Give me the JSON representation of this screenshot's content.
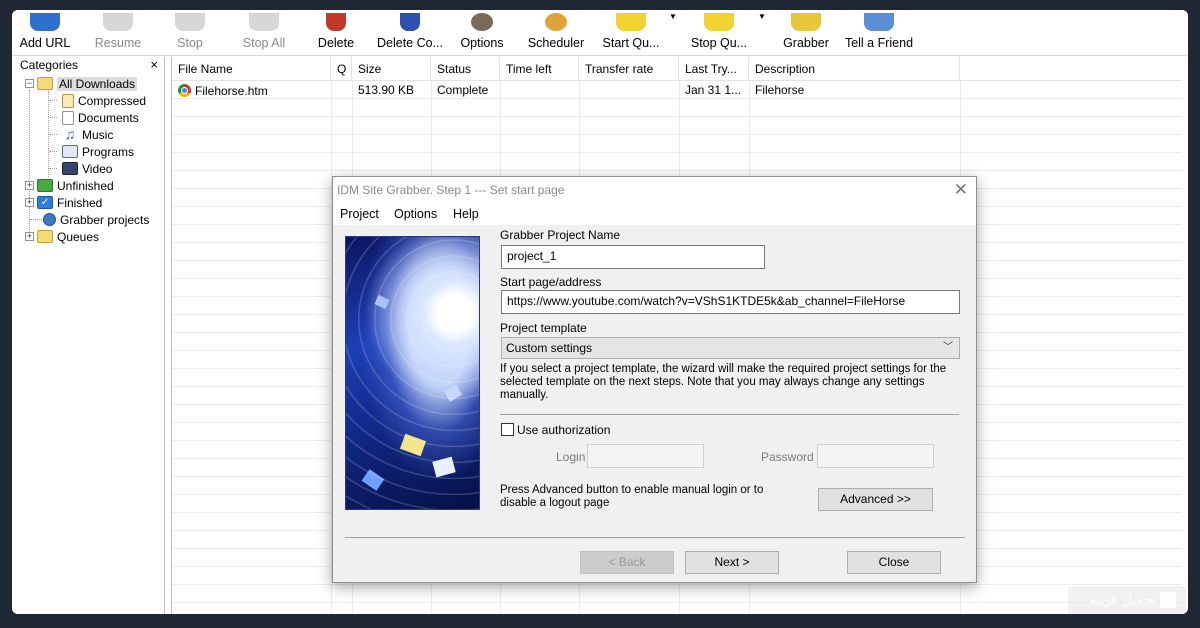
{
  "toolbar": {
    "buttons": [
      {
        "label": "Add URL",
        "enabled": true,
        "icon": "add-url-icon",
        "color": "#2f6fd0"
      },
      {
        "label": "Resume",
        "enabled": false,
        "icon": "resume-icon",
        "color": "#c9c9c9"
      },
      {
        "label": "Stop",
        "enabled": false,
        "icon": "stop-icon",
        "color": "#c9c9c9"
      },
      {
        "label": "Stop All",
        "enabled": false,
        "icon": "stop-all-icon",
        "color": "#c9c9c9"
      },
      {
        "label": "Delete",
        "enabled": true,
        "icon": "delete-icon",
        "color": "#c0392b"
      },
      {
        "label": "Delete Co...",
        "enabled": true,
        "icon": "delete-completed-icon",
        "color": "#2f50b0"
      },
      {
        "label": "Options",
        "enabled": true,
        "icon": "options-gear-icon",
        "color": "#6b6b6b"
      },
      {
        "label": "Scheduler",
        "enabled": true,
        "icon": "scheduler-clock-icon",
        "color": "#e0a23a"
      },
      {
        "label": "Start Qu...",
        "enabled": true,
        "icon": "start-queue-icon",
        "color": "#f1d234"
      },
      {
        "label": "Stop Qu...",
        "enabled": true,
        "icon": "stop-queue-icon",
        "color": "#f1d234"
      },
      {
        "label": "Grabber",
        "enabled": true,
        "icon": "grabber-icon",
        "color": "#f1d234"
      },
      {
        "label": "Tell a Friend",
        "enabled": true,
        "icon": "tell-friend-icon",
        "color": "#5a8fd8"
      }
    ]
  },
  "categories": {
    "header": "Categories",
    "close": "×",
    "items": [
      {
        "label": "All Downloads",
        "icon": "folder-open-icon",
        "expander": "−"
      },
      {
        "label": "Compressed",
        "icon": "compressed-file-icon"
      },
      {
        "label": "Documents",
        "icon": "document-icon"
      },
      {
        "label": "Music",
        "icon": "music-note-icon",
        "glyph": "♫"
      },
      {
        "label": "Programs",
        "icon": "program-window-icon"
      },
      {
        "label": "Video",
        "icon": "video-film-icon"
      },
      {
        "label": "Unfinished",
        "icon": "unfinished-icon",
        "expander": "+"
      },
      {
        "label": "Finished",
        "icon": "finished-check-icon",
        "expander": "+",
        "glyph": "✓"
      },
      {
        "label": "Grabber projects",
        "icon": "grabber-globe-icon"
      },
      {
        "label": "Queues",
        "icon": "queues-folder-icon",
        "expander": "+"
      }
    ]
  },
  "filelist": {
    "columns": [
      "File Name",
      "Q",
      "Size",
      "Status",
      "Time left",
      "Transfer rate",
      "Last Try...",
      "Description"
    ],
    "rows": [
      {
        "file_name": "Filehorse.htm",
        "q": "",
        "size": "513.90  KB",
        "status": "Complete",
        "time_left": "",
        "transfer_rate": "",
        "last_try": "Jan 31 1...",
        "description": "Filehorse"
      }
    ]
  },
  "dialog": {
    "title": "IDM Site Grabber. Step 1 --- Set start page",
    "close": "✕",
    "menu": [
      "Project",
      "Options",
      "Help"
    ],
    "project_name_label": "Grabber Project Name",
    "project_name_value": "project_1",
    "start_page_label": "Start page/address",
    "start_page_value": "https://www.youtube.com/watch?v=VShS1KTDE5k&ab_channel=FileHorse",
    "template_label": "Project template",
    "template_value": "Custom settings",
    "template_help": "If you select a project template, the wizard will make the required project settings for the selected template on the next steps. Note that you may always change any settings manually.",
    "use_auth_label": "Use authorization",
    "use_auth_checked": false,
    "login_label": "Login",
    "password_label": "Password",
    "advanced_help": "Press Advanced button to enable manual login or to disable a logout page",
    "advanced_button": "Advanced >>",
    "back_button": "< Back",
    "next_button": "Next >",
    "close_button": "Close"
  },
  "watermark": {
    "text": "تحميل عربية"
  }
}
